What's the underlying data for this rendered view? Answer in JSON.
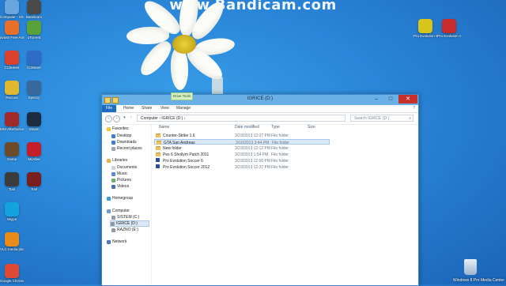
{
  "watermark": "www.Bandicam.com",
  "desktop_icons": [
    {
      "name": "Computer",
      "label": "Computer - Shortcut",
      "color": "#6aa6de"
    },
    {
      "name": "Bandicam",
      "label": "Bandicam",
      "color": "#4a4a4a"
    },
    {
      "name": "Avast",
      "label": "avast! Free Antivirus",
      "color": "#e8702a"
    },
    {
      "name": "uTorrent",
      "label": "uTorrent",
      "color": "#58a13b"
    },
    {
      "name": "CCleaner",
      "label": "CCleaner",
      "color": "#d9402e"
    },
    {
      "name": "Ccleaner2",
      "label": "Ccleaner",
      "color": "#2e6cc7"
    },
    {
      "name": "Recuva",
      "label": "Recuva",
      "color": "#e0b830"
    },
    {
      "name": "Speccy",
      "label": "Speccy",
      "color": "#37699e"
    },
    {
      "name": "Msi",
      "label": "MSI Afterburner",
      "color": "#a02a2a"
    },
    {
      "name": "Steam",
      "label": "Steam",
      "color": "#1c2c43"
    },
    {
      "name": "Game1",
      "label": "Game",
      "color": "#6b4b2a"
    },
    {
      "name": "McAfee",
      "label": "McAfee",
      "color": "#c21f2a"
    },
    {
      "name": "Tool1",
      "label": "Tool",
      "color": "#3b3b3b"
    },
    {
      "name": "Tool2",
      "label": "Tool",
      "color": "#7a1f1f"
    },
    {
      "name": "Skype",
      "label": "Skype",
      "color": "#14a3de"
    },
    {
      "name": "Vlc",
      "label": "VLC media player",
      "color": "#e88b1a"
    },
    {
      "name": "Chrome",
      "label": "Google Chrome",
      "color": "#de4935"
    },
    {
      "name": "PES",
      "label": "Pro Evolution Soccer",
      "color": "#d8c51c"
    },
    {
      "name": "PES2",
      "label": "Pro Evolution Soccer",
      "color": "#c82b2b"
    }
  ],
  "window": {
    "title": "IGRICE (D:)",
    "context_tab": "Drive Tools",
    "tabs": [
      "File",
      "Home",
      "Share",
      "View",
      "Manage"
    ],
    "address": "Computer  ›  IGRICE (D:)  ›",
    "search_placeholder": "Search IGRICE (D:)",
    "nav": {
      "favorites": "Favorites",
      "desktop": "Desktop",
      "downloads": "Downloads",
      "recent": "Recent places",
      "libraries": "Libraries",
      "documents": "Documents",
      "music": "Music",
      "pictures": "Pictures",
      "videos": "Videos",
      "homegroup": "Homegroup",
      "computer": "Computer",
      "drive_c": "SISTEM (C:)",
      "drive_d": "IGRICE (D:)",
      "drive_e": "RAZNO (E:)",
      "network": "Network"
    },
    "columns": {
      "name": "Name",
      "date": "Date modified",
      "type": "Type",
      "size": "Size"
    },
    "files": [
      {
        "name": "Counter-Strike 1.6",
        "date": "3/23/2013 12:27 PM",
        "type": "File folder",
        "kind": "folder"
      },
      {
        "name": "GTA San Andreas",
        "date": "3/16/2013 3:44 PM",
        "type": "File folder",
        "kind": "folder",
        "selected": true
      },
      {
        "name": "New folder",
        "date": "3/23/2013 12:12 PM",
        "type": "File folder",
        "kind": "folder"
      },
      {
        "name": "Pes 6 Shollym Patch 2011",
        "date": "3/23/2013 1:54 PM",
        "type": "File folder",
        "kind": "folder"
      },
      {
        "name": "Pro Evolution Soccer 6",
        "date": "3/23/2013 12:00 PM",
        "type": "File folder",
        "kind": "app"
      },
      {
        "name": "Pro Evolution Soccer 2012",
        "date": "3/23/2013 12:37 PM",
        "type": "File folder",
        "kind": "app"
      }
    ]
  },
  "taskbar_text": "Windows 8 Pro  Media Center",
  "colors": {
    "accent": "#1a6cc0",
    "selection": "#dbe9f7",
    "close": "#c7312b"
  }
}
